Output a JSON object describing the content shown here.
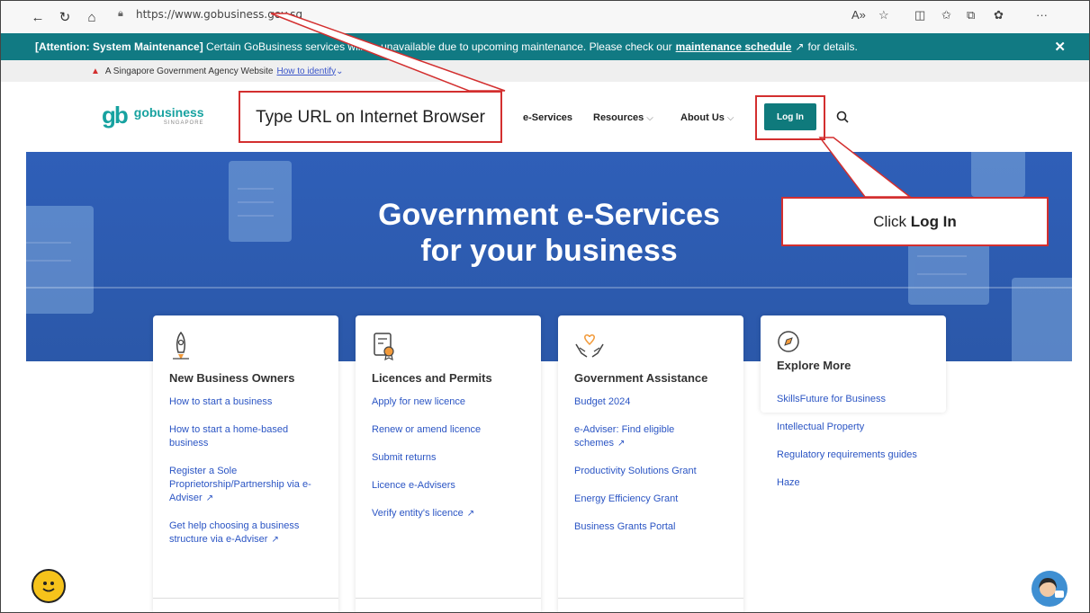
{
  "browser": {
    "url": "https://www.gobusiness.gov.sg"
  },
  "maintenance": {
    "prefix": "[Attention: System Maintenance]",
    "text": "Certain GoBusiness services will be unavailable due to upcoming maintenance. Please check our",
    "link": "maintenance schedule",
    "suffix": "for details.",
    "close": "✕"
  },
  "govstrip": {
    "text": "A Singapore Government Agency Website",
    "link": "How to identify"
  },
  "header": {
    "logo_mark": "gb",
    "logo_name": "gobusiness",
    "logo_sub": "SINGAPORE",
    "nav": [
      "e-Services",
      "Resources",
      "About Us"
    ],
    "login": "Log In"
  },
  "hero": {
    "line1": "Government e-Services",
    "line2": "for your business"
  },
  "cards": [
    {
      "title": "New Business Owners",
      "links": [
        {
          "text": "How to start a business",
          "ext": false
        },
        {
          "text": "How to start a home-based business",
          "ext": false
        },
        {
          "text": "Register a Sole Proprietorship/Partnership via e-Adviser",
          "ext": true
        },
        {
          "text": "Get help choosing a business structure via e-Adviser",
          "ext": true
        }
      ]
    },
    {
      "title": "Licences and Permits",
      "links": [
        {
          "text": "Apply for new licence",
          "ext": false
        },
        {
          "text": "Renew or amend licence",
          "ext": false
        },
        {
          "text": "Submit returns",
          "ext": false
        },
        {
          "text": "Licence e-Advisers",
          "ext": false
        },
        {
          "text": "Verify entity's licence",
          "ext": true
        }
      ]
    },
    {
      "title": "Government Assistance",
      "links": [
        {
          "text": "Budget 2024",
          "ext": false
        },
        {
          "text": "e-Adviser: Find eligible schemes",
          "ext": true
        },
        {
          "text": "Productivity Solutions Grant",
          "ext": false
        },
        {
          "text": "Energy Efficiency Grant",
          "ext": false
        },
        {
          "text": "Business Grants Portal",
          "ext": false
        }
      ]
    },
    {
      "title": "Explore More",
      "links": [
        {
          "text": "SkillsFuture for Business",
          "ext": false
        },
        {
          "text": "Intellectual Property",
          "ext": false
        },
        {
          "text": "Regulatory requirements guides",
          "ext": false
        },
        {
          "text": "Haze",
          "ext": false
        }
      ]
    }
  ],
  "annotations": {
    "url_hint": "Type URL on Internet Browser",
    "login_hint_prefix": "Click",
    "login_hint_bold": "Log In"
  },
  "colors": {
    "teal": "#117a83",
    "hero_blue": "#2f5fb8",
    "link_blue": "#2b55c4",
    "annotation_red": "#d32f2f"
  }
}
